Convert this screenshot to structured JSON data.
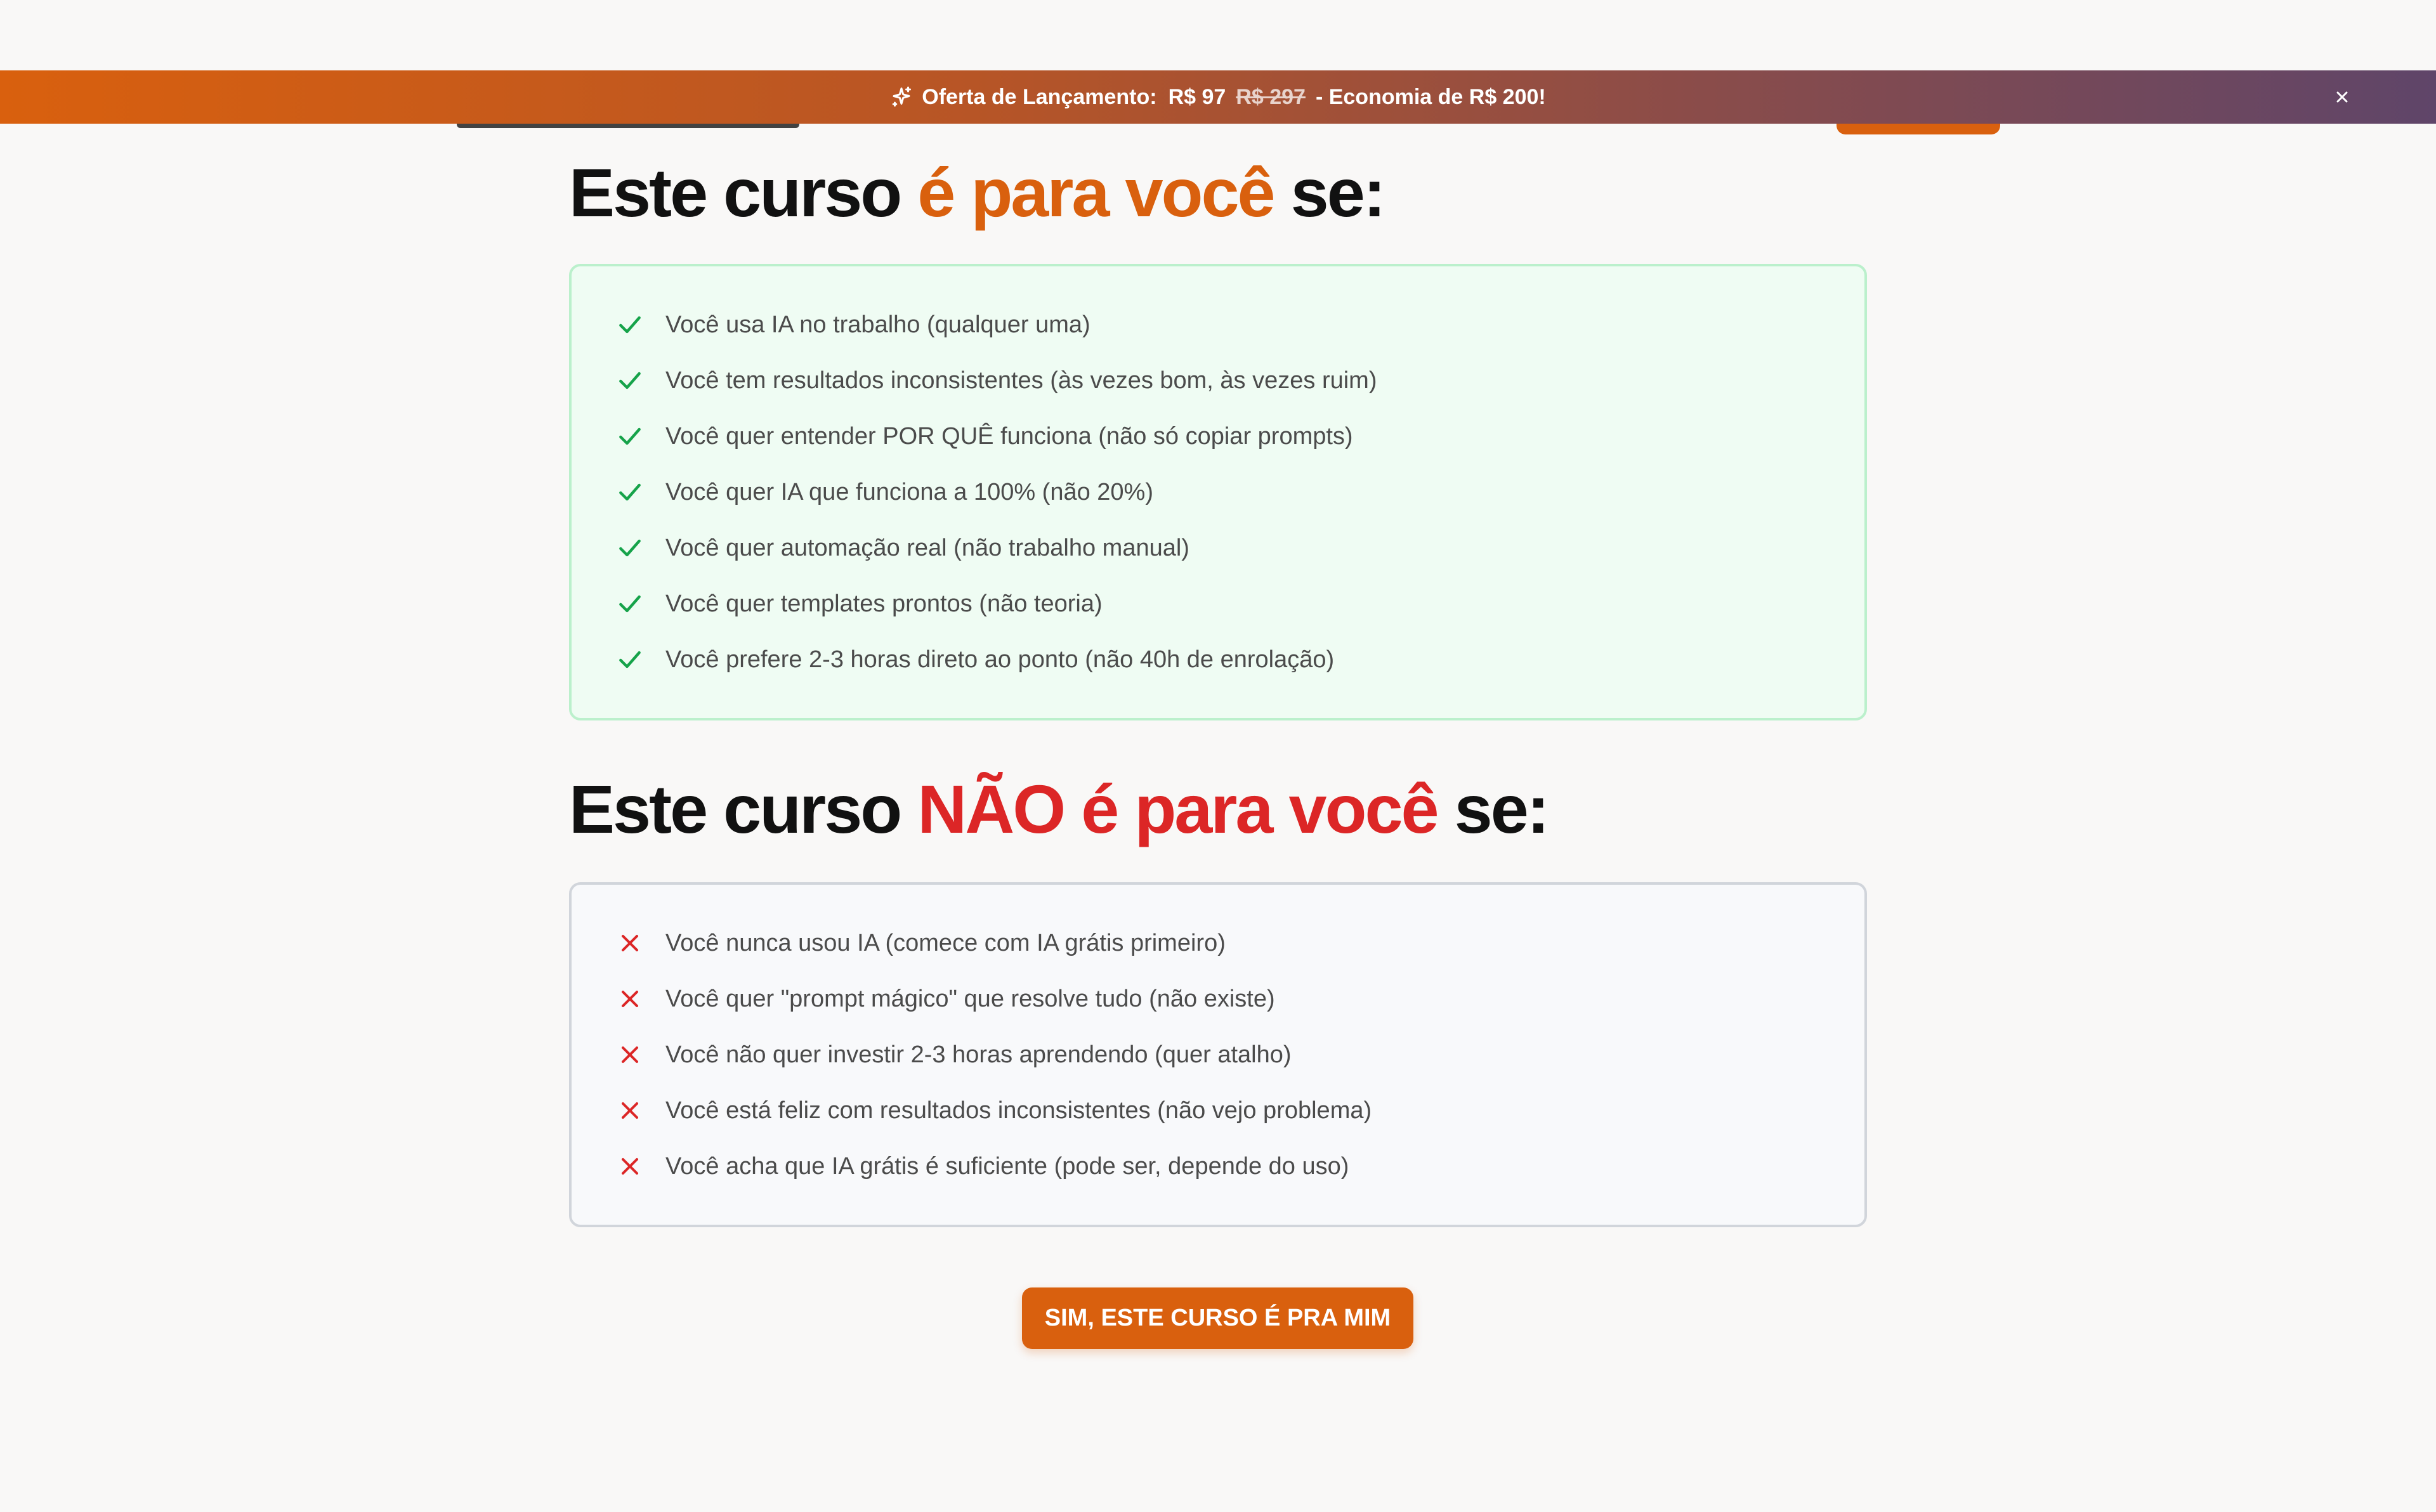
{
  "promo_banner": {
    "label": "Oferta de Lançamento:",
    "price": "R$ 97",
    "old_price": "R$ 297",
    "savings": "- Economia de R$ 200!",
    "icon": "sparkle-icon",
    "close_icon": "close-icon"
  },
  "for_you": {
    "title_prefix": "Este curso ",
    "title_highlight": "é para você",
    "title_suffix": " se:",
    "item_icon": "check-icon",
    "items": [
      "Você usa IA no trabalho (qualquer uma)",
      "Você tem resultados inconsistentes (às vezes bom, às vezes ruim)",
      "Você quer entender POR QUÊ funciona (não só copiar prompts)",
      "Você quer IA que funciona a 100% (não 20%)",
      "Você quer automação real (não trabalho manual)",
      "Você quer templates prontos (não teoria)",
      "Você prefere 2-3 horas direto ao ponto (não 40h de enrolação)"
    ]
  },
  "not_for_you": {
    "title_prefix": "Este curso ",
    "title_highlight": "NÃO é para você",
    "title_suffix": " se:",
    "item_icon": "x-icon",
    "items": [
      "Você nunca usou IA (comece com IA grátis primeiro)",
      "Você quer \"prompt mágico\" que resolve tudo (não existe)",
      "Você não quer investir 2-3 horas aprendendo (quer atalho)",
      "Você está feliz com resultados inconsistentes (não vejo problema)",
      "Você acha que IA grátis é suficiente (pode ser, depende do uso)"
    ]
  },
  "cta": {
    "label": "SIM, ESTE CURSO É PRA MIM"
  },
  "colors": {
    "brand_orange": "#d9600e",
    "danger_red": "#dc2626",
    "success_green": "#16a34a"
  }
}
